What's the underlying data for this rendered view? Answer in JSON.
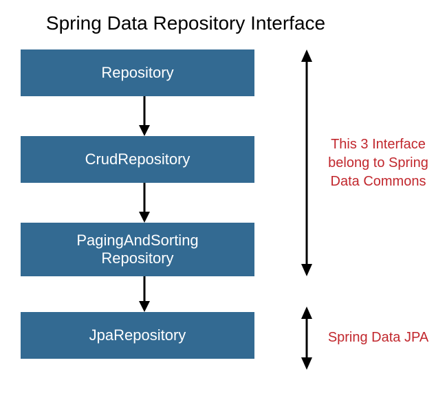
{
  "title": "Spring Data Repository Interface",
  "boxes": {
    "repository": "Repository",
    "crudRepository": "CrudRepository",
    "pagingAndSorting_line1": "PagingAndSorting",
    "pagingAndSorting_line2": "Repository",
    "jpaRepository": "JpaRepository"
  },
  "annotations": {
    "commons_line1": "This 3 Interface",
    "commons_line2": "belong to Spring",
    "commons_line3": "Data Commons",
    "jpa": "Spring Data JPA"
  }
}
